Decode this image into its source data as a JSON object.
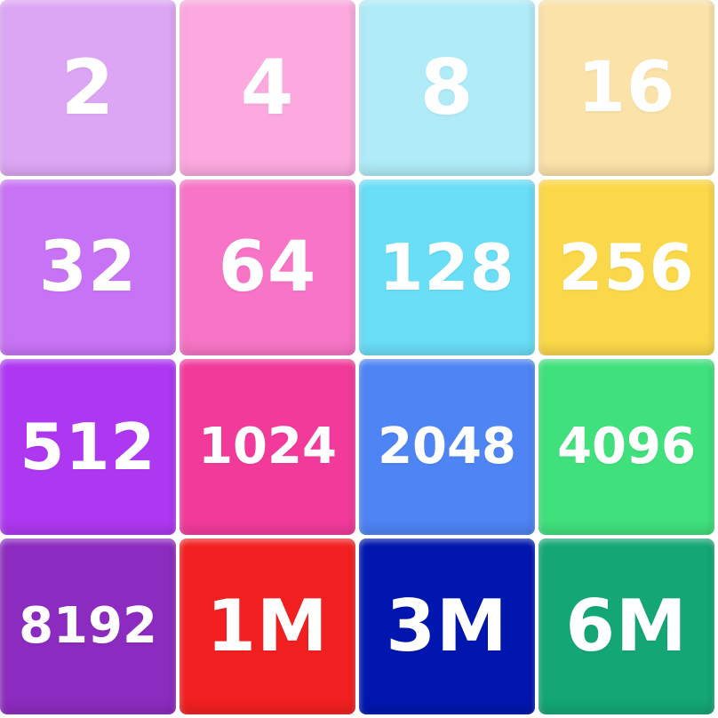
{
  "board": {
    "tiles": [
      {
        "value": "2",
        "color": "#DDA6F5"
      },
      {
        "value": "4",
        "color": "#FBA9DF"
      },
      {
        "value": "8",
        "color": "#B0EBF8"
      },
      {
        "value": "16",
        "color": "#FBE2A9"
      },
      {
        "value": "32",
        "color": "#C873F5"
      },
      {
        "value": "64",
        "color": "#F774C6"
      },
      {
        "value": "128",
        "color": "#6ADDF7"
      },
      {
        "value": "256",
        "color": "#FBD84A"
      },
      {
        "value": "512",
        "color": "#AE38F2"
      },
      {
        "value": "1024",
        "color": "#F23A9B"
      },
      {
        "value": "2048",
        "color": "#4E84F4"
      },
      {
        "value": "4096",
        "color": "#40E07C"
      },
      {
        "value": "8192",
        "color": "#8C2BBF"
      },
      {
        "value": "1M",
        "color": "#F22020"
      },
      {
        "value": "3M",
        "color": "#0016AE"
      },
      {
        "value": "6M",
        "color": "#14A674"
      }
    ]
  }
}
